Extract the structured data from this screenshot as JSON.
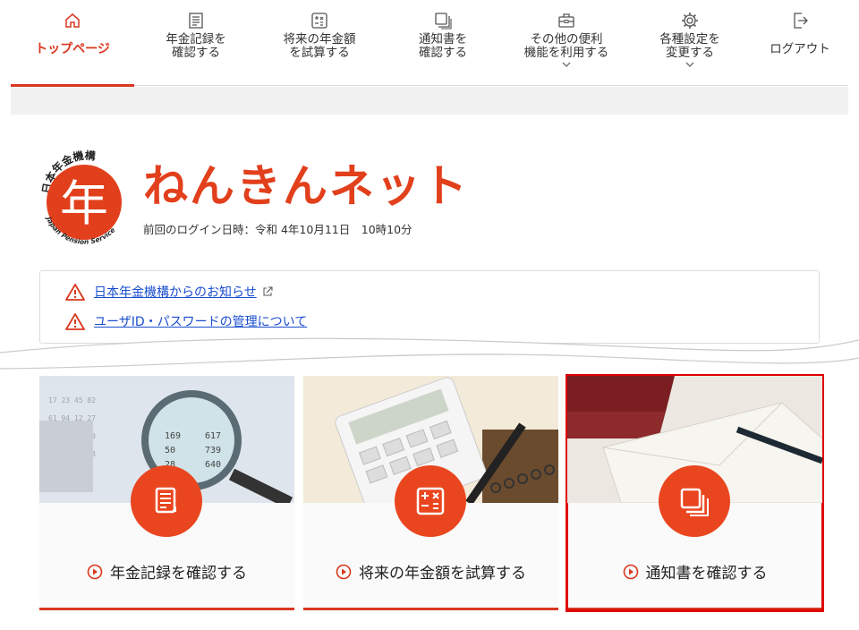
{
  "nav": {
    "items": [
      {
        "label": "トップページ",
        "icon": "home-icon",
        "active": true
      },
      {
        "label": "年金記録を\n確認する",
        "icon": "record-icon"
      },
      {
        "label": "将来の年金額\nを試算する",
        "icon": "calculator-icon"
      },
      {
        "label": "通知書を\n確認する",
        "icon": "documents-icon"
      },
      {
        "label": "その他の便利\n機能を利用する",
        "icon": "toolbox-icon",
        "dropdown": true
      },
      {
        "label": "各種設定を\n変更する",
        "icon": "gear-icon",
        "dropdown": true
      },
      {
        "label": "ログアウト",
        "icon": "logout-icon"
      }
    ]
  },
  "header": {
    "logo_text_top": "日本年金機構",
    "logo_text_bottom": "Japan Pension Service",
    "logo_glyph": "年",
    "brand": "ねんきんネット",
    "last_login": "前回のログイン日時：令和 4年10月11日　10時10分"
  },
  "notices": [
    {
      "text": "日本年金機構からのお知らせ",
      "external": true
    },
    {
      "text": "ユーザID・パスワードの管理について",
      "external": false
    }
  ],
  "tiles": [
    {
      "label": "年金記録を確認する",
      "icon": "record-icon"
    },
    {
      "label": "将来の年金額を試算する",
      "icon": "calculator-icon"
    },
    {
      "label": "通知書を確認する",
      "icon": "documents-icon",
      "selected": true
    }
  ],
  "colors": {
    "accent": "#d9381e",
    "link": "#1a4ecf",
    "selection": "#e00000"
  }
}
